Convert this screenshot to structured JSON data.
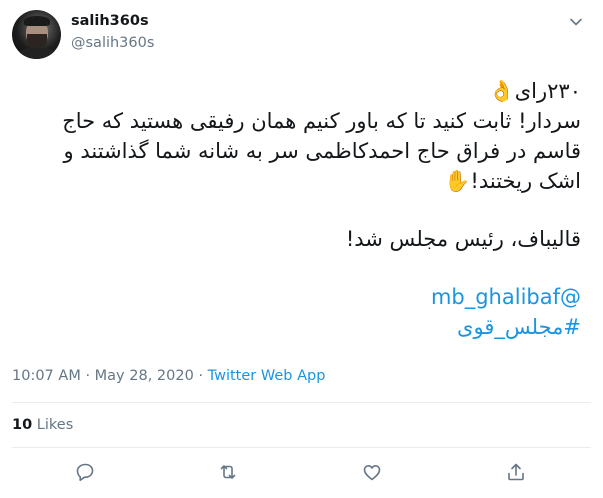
{
  "author": {
    "name": "salih360s",
    "handle": "@salih360s"
  },
  "tweet": {
    "lines": [
      "۲۳۰رای👌",
      "سردار! ثابت کنید تا که باور کنیم همان رفیقی هستید که حاج",
      "قاسم در فراق حاج احمدکاظمی سر به شانه شما گذاشتند و",
      "اشک ریختند!✋"
    ],
    "line2": "قالیباف، رئیس مجلس شد!",
    "mention": "@mb_ghalibaf",
    "hashtag": "#مجلس_قوی"
  },
  "meta": {
    "time": "10:07 AM",
    "separator": "·",
    "date": "May 28, 2020",
    "source": "Twitter Web App"
  },
  "stats": {
    "likes_count": "10",
    "likes_label": "Likes"
  },
  "icons": {
    "caret": "chevron-down-icon",
    "reply": "reply-icon",
    "retweet": "retweet-icon",
    "like": "heart-icon",
    "share": "share-icon"
  },
  "colors": {
    "link": "#1b95e0",
    "muted": "#657786",
    "text": "#14171a",
    "divider": "#e6ecf0"
  }
}
